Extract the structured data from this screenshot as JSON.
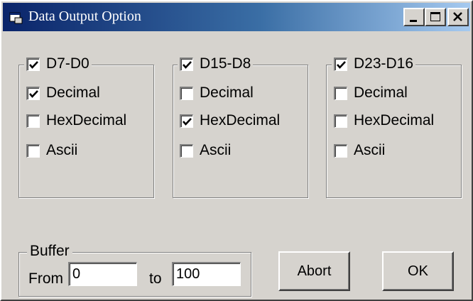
{
  "window": {
    "title": "Data Output Option"
  },
  "groups": [
    {
      "header": {
        "label": "D7-D0",
        "checked": true
      },
      "options": [
        {
          "label": "Decimal",
          "checked": true
        },
        {
          "label": "HexDecimal",
          "checked": false
        },
        {
          "label": "Ascii",
          "checked": false
        }
      ]
    },
    {
      "header": {
        "label": "D15-D8",
        "checked": true
      },
      "options": [
        {
          "label": "Decimal",
          "checked": false
        },
        {
          "label": "HexDecimal",
          "checked": true
        },
        {
          "label": "Ascii",
          "checked": false
        }
      ]
    },
    {
      "header": {
        "label": "D23-D16",
        "checked": true
      },
      "options": [
        {
          "label": "Decimal",
          "checked": false
        },
        {
          "label": "HexDecimal",
          "checked": false
        },
        {
          "label": "Ascii",
          "checked": false
        }
      ]
    }
  ],
  "buffer": {
    "title": "Buffer",
    "from_label": "From",
    "from_value": "0",
    "to_label": "to",
    "to_value": "100"
  },
  "buttons": {
    "abort": "Abort",
    "ok": "OK"
  }
}
